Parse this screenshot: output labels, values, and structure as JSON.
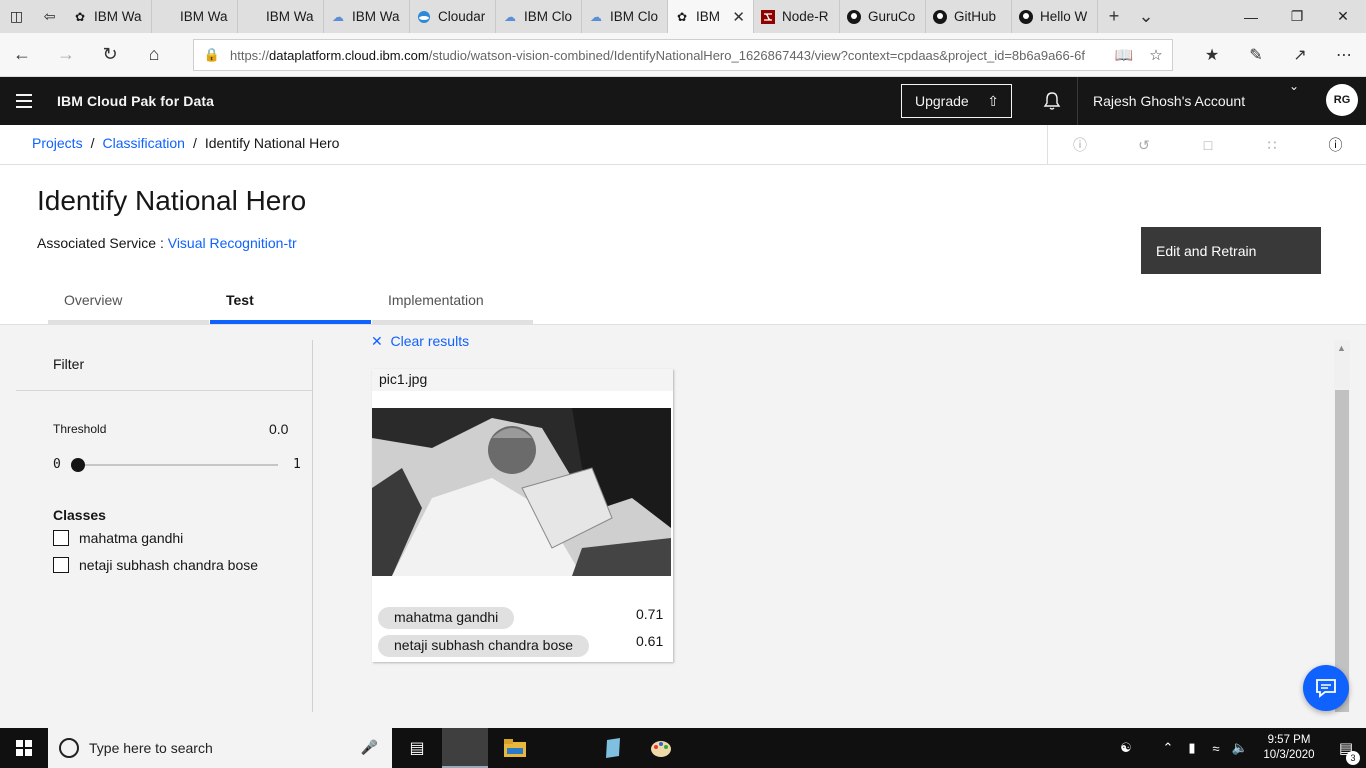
{
  "browser": {
    "tabs": [
      {
        "title": "IBM Wa",
        "icon": "ibm-bee-icon"
      },
      {
        "title": "IBM Wa",
        "icon": "blank-icon"
      },
      {
        "title": "IBM Wa",
        "icon": "blank-icon"
      },
      {
        "title": "IBM Wa",
        "icon": "cloud-icon"
      },
      {
        "title": "Cloudar",
        "icon": "cloudant-icon"
      },
      {
        "title": "IBM Clo",
        "icon": "cloud-icon"
      },
      {
        "title": "IBM Clo",
        "icon": "cloud-icon"
      },
      {
        "title": "IBM",
        "icon": "ibm-bee-icon",
        "active": true
      },
      {
        "title": "Node-R",
        "icon": "node-red-icon"
      },
      {
        "title": "GuruCo",
        "icon": "github-icon"
      },
      {
        "title": "GitHub",
        "icon": "github-icon"
      },
      {
        "title": "Hello W",
        "icon": "github-icon"
      }
    ],
    "url_prefix": "https://",
    "url_host": "dataplatform.cloud.ibm.com",
    "url_path": "/studio/watson-vision-combined/IdentifyNationalHero_1626867443/view?context=cpdaas&project_id=8b6a9a66-6f",
    "accent": "#0f62fe"
  },
  "header": {
    "product": "IBM Cloud Pak for Data",
    "upgrade_label": "Upgrade",
    "account": "Rajesh Ghosh's Account",
    "avatar_initials": "RG"
  },
  "breadcrumb": {
    "items": [
      "Projects",
      "Classification"
    ],
    "current": "Identify National Hero",
    "separator": "/"
  },
  "page": {
    "title": "Identify National Hero",
    "assoc_label": "Associated Service : ",
    "assoc_link": "Visual Recognition-tr",
    "retrain_label": "Edit and Retrain",
    "tabs": [
      "Overview",
      "Test",
      "Implementation"
    ],
    "active_tab": "Test"
  },
  "filter": {
    "title": "Filter",
    "threshold_label": "Threshold",
    "threshold_value": "0.0",
    "slider_min": "0",
    "slider_max": "1",
    "classes_title": "Classes",
    "classes": [
      "mahatma gandhi",
      "netaji subhash chandra bose"
    ]
  },
  "results": {
    "clear_label": "Clear results",
    "card": {
      "filename": "pic1.jpg",
      "tags": [
        {
          "label": "mahatma gandhi",
          "score": "0.71"
        },
        {
          "label": "netaji subhash chandra bose",
          "score": "0.61"
        }
      ]
    }
  },
  "taskbar": {
    "search_placeholder": "Type here to search",
    "time": "9:57 PM",
    "date": "10/3/2020",
    "notification_count": "3"
  }
}
